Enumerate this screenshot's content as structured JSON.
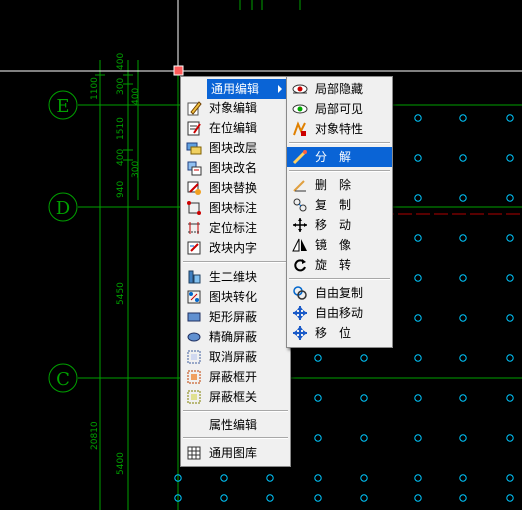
{
  "drawing": {
    "axis_labels": [
      "E",
      "D",
      "C"
    ],
    "dimensions": [
      "1100",
      "300",
      "400",
      "400",
      "1510",
      "400",
      "300",
      "940",
      "5450",
      "20810",
      "5400"
    ],
    "colors": {
      "grid": "#00aa00",
      "dot": "#00d0ff",
      "red": "#c00000",
      "cursor": "#ffffff"
    }
  },
  "context_menu": {
    "items": [
      {
        "label": "通用编辑",
        "icon": "none",
        "submenu": true
      },
      {
        "label": "对象编辑",
        "icon": "edit-pencil-icon"
      },
      {
        "label": "在位编辑",
        "icon": "in-place-edit-icon"
      },
      {
        "label": "图块改层",
        "icon": "block-layer-icon"
      },
      {
        "label": "图块改名",
        "icon": "block-rename-icon"
      },
      {
        "label": "图块替换",
        "icon": "block-replace-icon"
      },
      {
        "label": "图块标注",
        "icon": "block-annotate-icon"
      },
      {
        "label": "定位标注",
        "icon": "position-annotate-icon"
      },
      {
        "label": "改块内字",
        "icon": "block-text-icon"
      },
      {
        "label": "生二维块",
        "icon": "make-2d-block-icon"
      },
      {
        "label": "图块转化",
        "icon": "block-convert-icon"
      },
      {
        "label": "矩形屏蔽",
        "icon": "rect-mask-icon"
      },
      {
        "label": "精确屏蔽",
        "icon": "precise-mask-icon"
      },
      {
        "label": "取消屏蔽",
        "icon": "cancel-mask-icon"
      },
      {
        "label": "屏蔽框开",
        "icon": "mask-frame-on-icon"
      },
      {
        "label": "屏蔽框关",
        "icon": "mask-frame-off-icon"
      },
      {
        "label": "属性编辑",
        "icon": "none"
      },
      {
        "label": "通用图库",
        "icon": "library-grid-icon"
      }
    ]
  },
  "submenu": {
    "items": [
      {
        "label": "局部隐藏",
        "icon": "eye-hide-icon"
      },
      {
        "label": "局部可见",
        "icon": "eye-show-icon"
      },
      {
        "label": "对象特性",
        "icon": "properties-icon"
      },
      {
        "label": "分　解",
        "icon": "explode-icon"
      },
      {
        "label": "删　除",
        "icon": "erase-icon"
      },
      {
        "label": "复　制",
        "icon": "copy-icon"
      },
      {
        "label": "移　动",
        "icon": "move-icon"
      },
      {
        "label": "镜　像",
        "icon": "mirror-icon"
      },
      {
        "label": "旋　转",
        "icon": "rotate-icon"
      },
      {
        "label": "自由复制",
        "icon": "free-copy-icon"
      },
      {
        "label": "自由移动",
        "icon": "free-move-icon"
      },
      {
        "label": "移　位",
        "icon": "shift-icon"
      }
    ]
  }
}
